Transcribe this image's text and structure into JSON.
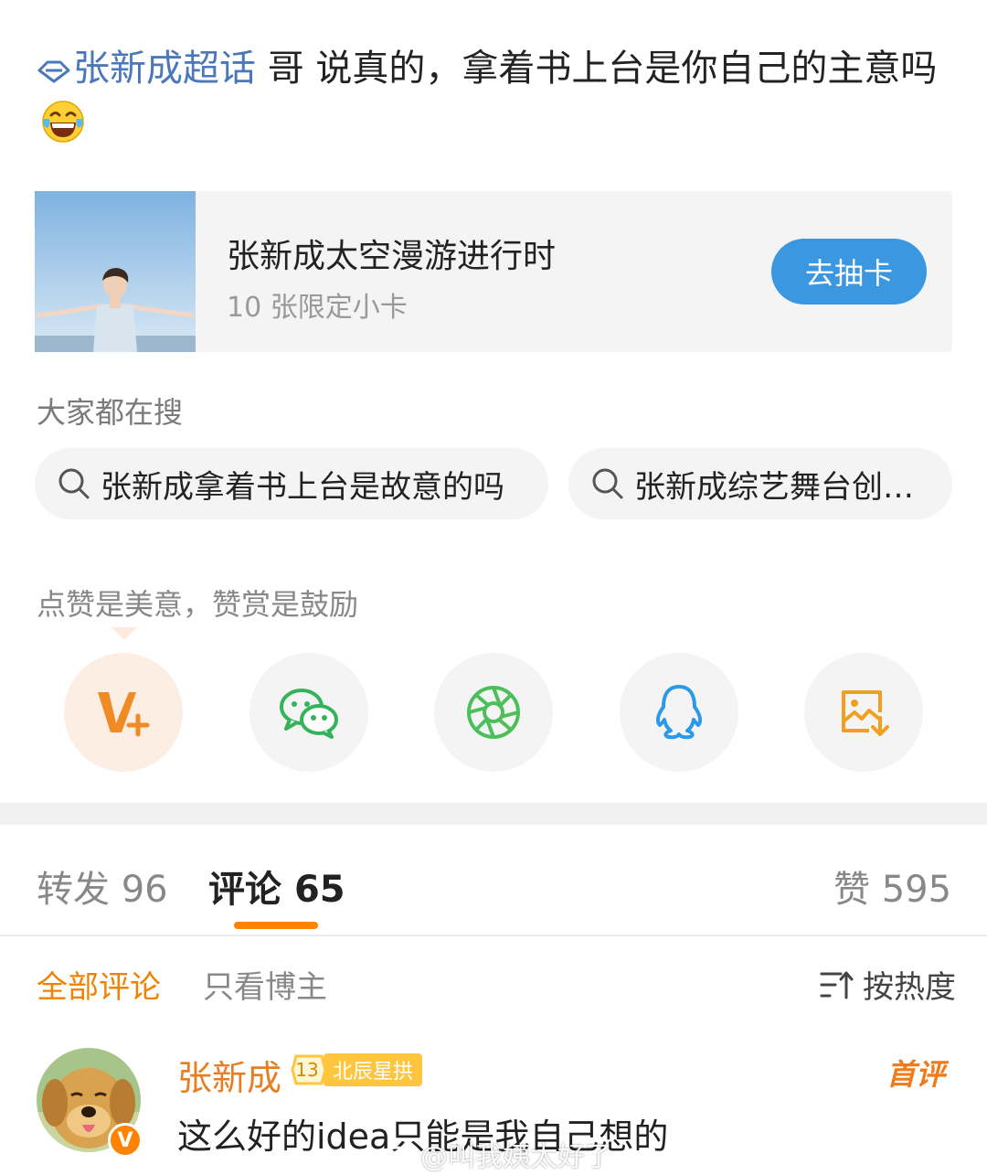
{
  "post": {
    "topic": "张新成超话",
    "text": " 哥 说真的，拿着书上台是你自己的主意吗"
  },
  "card": {
    "title": "张新成太空漫游进行时",
    "subtitle": "10 张限定小卡",
    "button": "去抽卡"
  },
  "search": {
    "title": "大家都在搜",
    "items": [
      "张新成拿着书上台是故意的吗",
      "张新成综艺舞台创…"
    ]
  },
  "reward": {
    "text": "点赞是美意，赞赏是鼓励",
    "share_icons": [
      "v-plus-icon",
      "wechat-icon",
      "moments-icon",
      "qq-icon",
      "save-image-icon"
    ]
  },
  "tabs": {
    "repost_label": "转发",
    "repost_count": "96",
    "comment_label": "评论",
    "comment_count": "65",
    "like_label": "赞",
    "like_count": "595"
  },
  "filters": {
    "all": "全部评论",
    "author_only": "只看博主",
    "sort": "按热度"
  },
  "comment": {
    "name": "张新成",
    "level": "13",
    "level_name": "北辰星拱",
    "first_badge": "首评",
    "text": "这么好的idea只能是我自己想的"
  },
  "watermark": "@叫我姨太好了",
  "colors": {
    "accent": "#ff8200",
    "link": "#4a78b8",
    "button": "#3b97e0"
  }
}
